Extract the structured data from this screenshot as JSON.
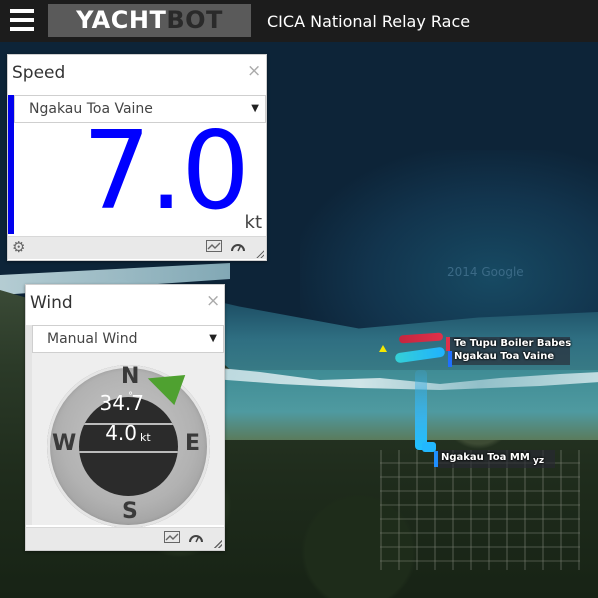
{
  "header": {
    "logo_part1": "YACHT",
    "logo_part2": "BOT",
    "title": "CICA National Relay Race"
  },
  "map": {
    "copyright": "2014 Google",
    "boats": [
      {
        "label": "Te Tupu Boiler Babes",
        "color": "#e0304a"
      },
      {
        "label": "Ngakau Toa Vaine",
        "color": "#1f6fff"
      },
      {
        "label": "Ngakau Toa MM",
        "color": "#1f8fff"
      }
    ],
    "label_tail": "yz"
  },
  "speed_panel": {
    "title": "Speed",
    "close": "×",
    "selected_boat": "Ngakau Toa Vaine",
    "value": "7.0",
    "unit": "kt",
    "accent_color": "#0000ee",
    "icons": [
      "gear-icon",
      "chart-icon",
      "gauge-icon"
    ]
  },
  "wind_panel": {
    "title": "Wind",
    "close": "×",
    "source": "Manual Wind",
    "direction": "34.7",
    "degree_symbol": "°",
    "speed": "4.0",
    "unit": "kt",
    "cardinals": {
      "n": "N",
      "s": "S",
      "w": "W",
      "e": "E"
    },
    "arrow_color": "#4fa130",
    "icons": [
      "chart-icon",
      "gauge-icon"
    ]
  }
}
